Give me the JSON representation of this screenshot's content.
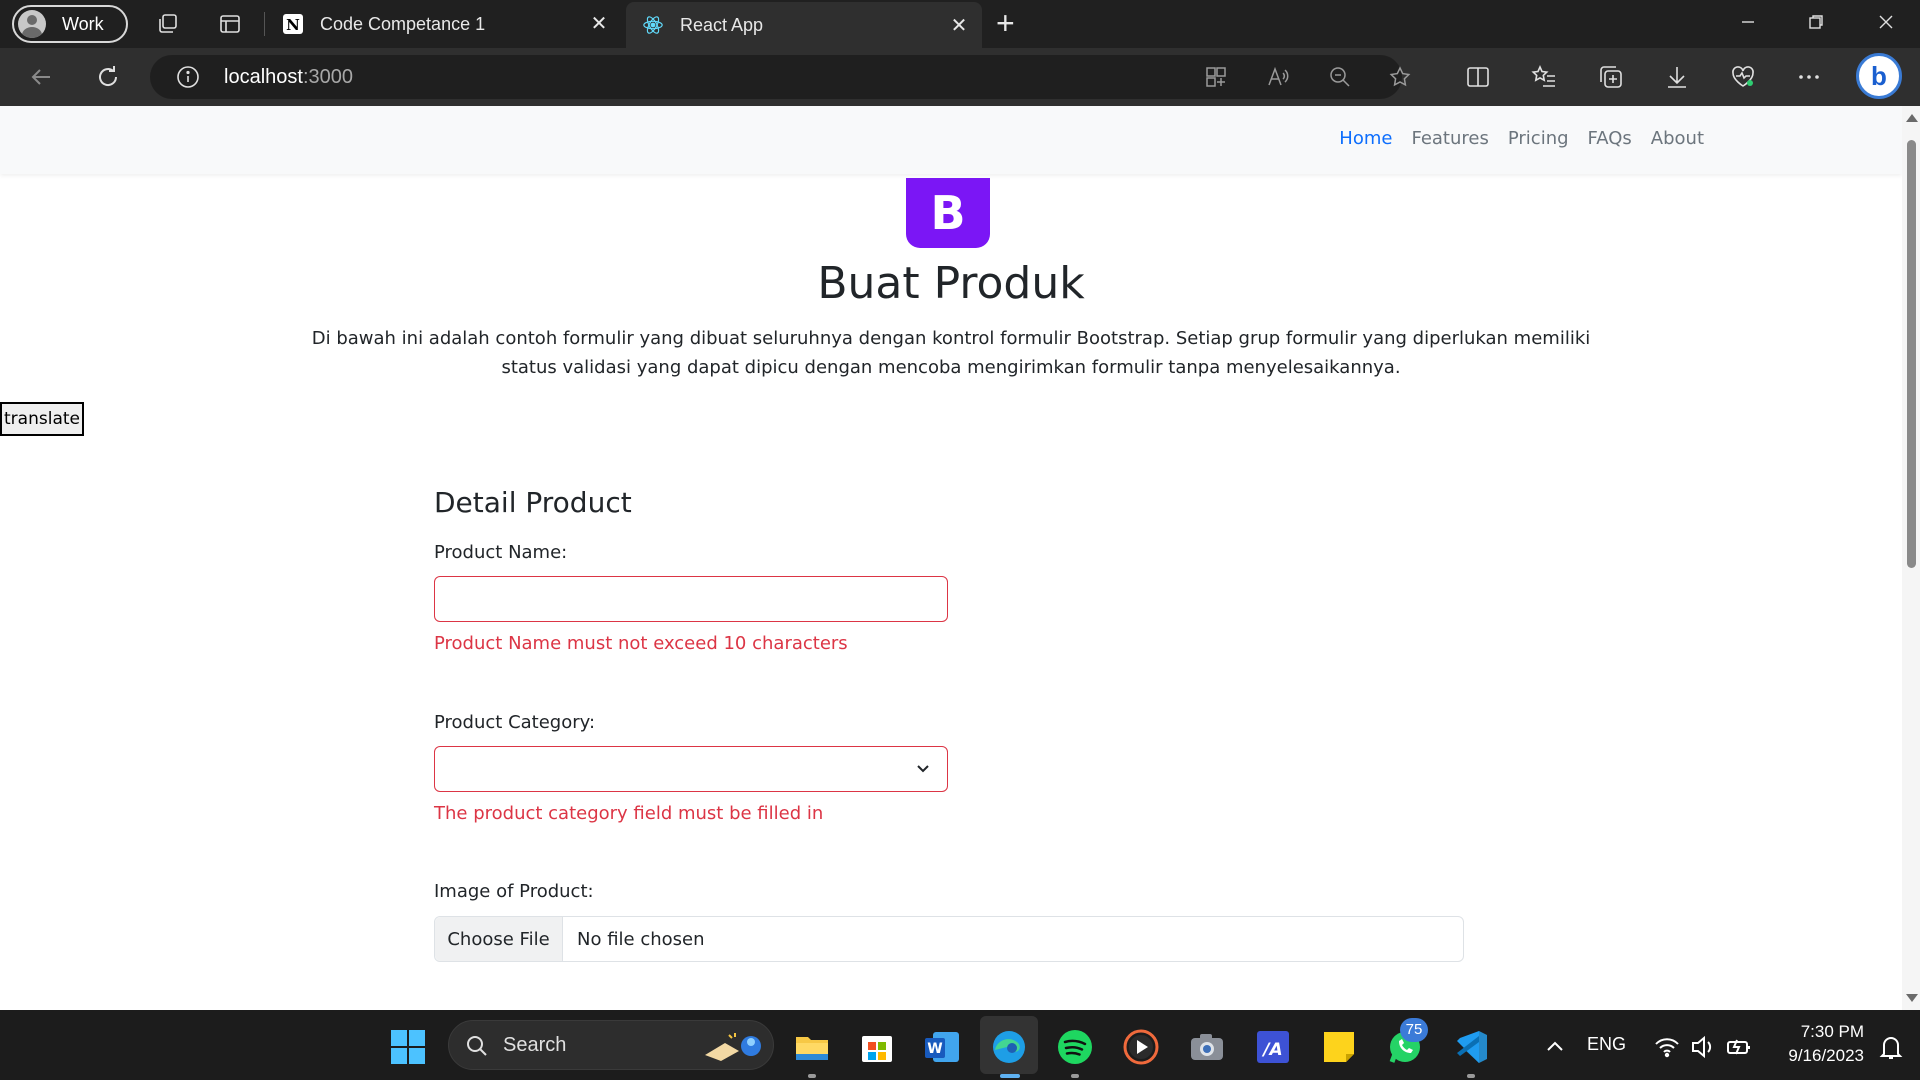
{
  "browser": {
    "profile_label": "Work",
    "tabs": [
      {
        "title": "Code Competance 1",
        "favicon": "notion-icon"
      },
      {
        "title": "React App",
        "favicon": "react-icon"
      }
    ],
    "address": {
      "host": "localhost",
      "port": ":3000"
    }
  },
  "site": {
    "nav": [
      "Home",
      "Features",
      "Pricing",
      "FAQs",
      "About"
    ],
    "active_nav": "Home",
    "logo_letter": "B",
    "heading": "Buat Produk",
    "lead": "Di bawah ini adalah contoh formulir yang dibuat seluruhnya dengan kontrol formulir Bootstrap. Setiap grup formulir yang diperlukan memiliki status validasi yang dapat dipicu dengan mencoba mengirimkan formulir tanpa menyelesaikannya.",
    "translate_label": "translate"
  },
  "form": {
    "section_title": "Detail Product",
    "product_name": {
      "label": "Product Name:",
      "value": "",
      "error": "Product Name must not exceed 10 characters"
    },
    "product_category": {
      "label": "Product Category:",
      "value": "",
      "error": "The product category field must be filled in"
    },
    "image": {
      "label": "Image of Product:",
      "button": "Choose File",
      "status": "No file chosen"
    }
  },
  "taskbar": {
    "search_label": "Search",
    "whatsapp_badge": "75",
    "language": "ENG",
    "time": "7:30 PM",
    "date": "9/16/2023"
  },
  "colors": {
    "accent": "#0d6efd",
    "error": "#dc3545",
    "logo_purple": "#7b16f5"
  }
}
